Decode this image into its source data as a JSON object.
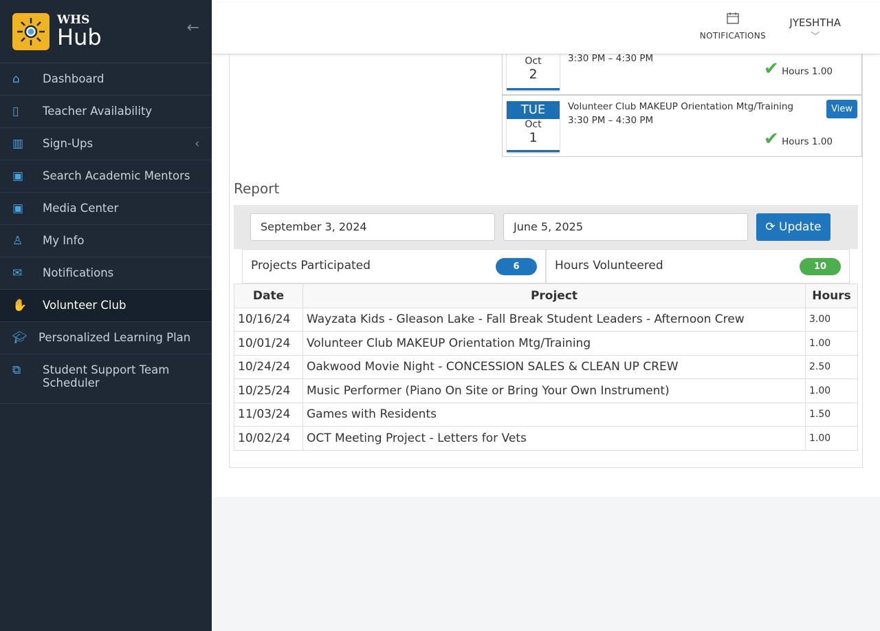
{
  "logo": {
    "top": "WHS",
    "bottom": "Hub"
  },
  "sidebar": {
    "items": [
      {
        "label": "Dashboard",
        "icon": "home-icon"
      },
      {
        "label": "Teacher Availability",
        "icon": "tablet-icon"
      },
      {
        "label": "Sign-Ups",
        "icon": "map-icon"
      },
      {
        "label": "Search Academic Mentors",
        "icon": "calendar-icon"
      },
      {
        "label": "Media Center",
        "icon": "calendar-icon"
      },
      {
        "label": "My Info",
        "icon": "user-icon"
      },
      {
        "label": "Notifications",
        "icon": "envelope-icon"
      },
      {
        "label": "Volunteer Club",
        "icon": "hand-icon"
      },
      {
        "label": "Personalized Learning Plan",
        "icon": "graduation-cap-icon"
      },
      {
        "label": "Student Support Team Scheduler",
        "icon": "external-link-icon"
      }
    ]
  },
  "topbar": {
    "notifications": "NOTIFICATIONS",
    "user": "JYESHTHA"
  },
  "events": [
    {
      "month": "Oct",
      "day": "2",
      "time": "3:30 PM – 4:30 PM",
      "hours": "Hours 1.00"
    },
    {
      "dow": "TUE",
      "month": "Oct",
      "day": "1",
      "title": "Volunteer Club MAKEUP Orientation Mtg/Training",
      "time": "3:30 PM – 4:30 PM",
      "hours": "Hours 1.00",
      "view": "View"
    }
  ],
  "report": {
    "title": "Report",
    "start": "September 3, 2024",
    "end": "June 5, 2025",
    "update": "Update",
    "projects_label": "Projects Participated",
    "projects_count": "6",
    "hours_label": "Hours Volunteered",
    "hours_count": "10",
    "columns": [
      "Date",
      "Project",
      "Hours"
    ],
    "rows": [
      [
        "10/16/24",
        "Wayzata Kids - Gleason Lake - Fall Break Student Leaders - Afternoon Crew",
        "3.00"
      ],
      [
        "10/01/24",
        "Volunteer Club MAKEUP Orientation Mtg/Training",
        "1.00"
      ],
      [
        "10/24/24",
        "Oakwood Movie Night - CONCESSION SALES & CLEAN UP CREW",
        "2.50"
      ],
      [
        "10/25/24",
        "Music Performer (Piano On Site or Bring Your Own Instrument)",
        "1.00"
      ],
      [
        "11/03/24",
        "Games with Residents",
        "1.50"
      ],
      [
        "10/02/24",
        "OCT Meeting Project - Letters for Vets",
        "1.00"
      ]
    ]
  },
  "colors": {
    "sidebar": "#1e2935",
    "accent": "#1f76bd",
    "success": "#4cae4c",
    "logo": "#f0b323"
  }
}
